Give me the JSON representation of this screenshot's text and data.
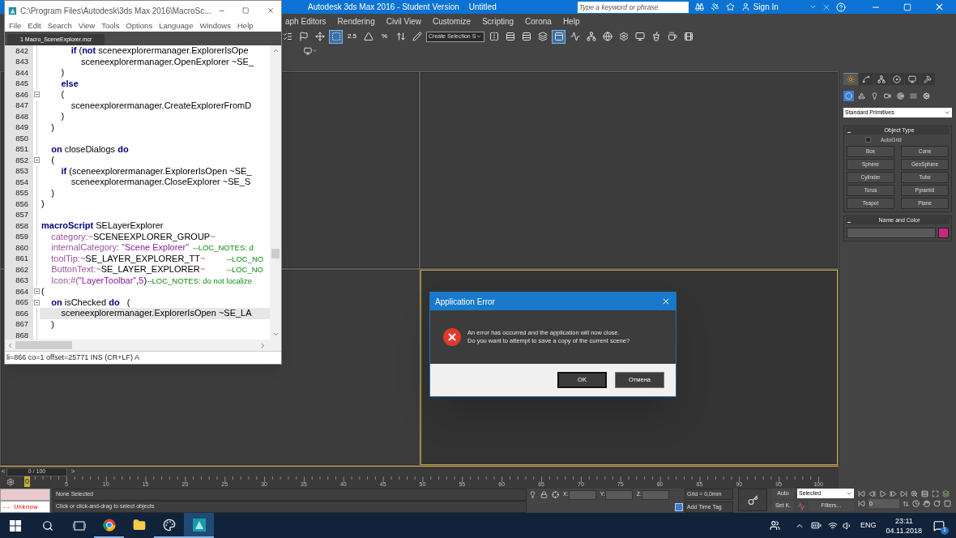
{
  "app_window": {
    "title": "Autodesk 3ds Max 2016 - Student Version",
    "document": "Untitled",
    "search": {
      "placeholder": "Type a keyword or phrase"
    },
    "sign_in": "Sign In"
  },
  "menu": [
    "aph Editors",
    "Rendering",
    "Civil View",
    "Customize",
    "Scripting",
    "Corona",
    "Help"
  ],
  "toolbar": [
    {
      "kind": "icon",
      "selected": false
    },
    {
      "kind": "icon",
      "selected": false
    },
    {
      "kind": "icon",
      "selected": false
    },
    {
      "kind": "icon",
      "selected": true
    },
    {
      "kind": "text",
      "label": "2.5",
      "selected": false
    },
    {
      "kind": "icon",
      "selected": false
    },
    {
      "kind": "text",
      "label": "%",
      "selected": false
    },
    {
      "kind": "icon",
      "selected": false
    },
    {
      "kind": "icon",
      "selected": false
    },
    {
      "kind": "dropdown",
      "label": "Create Selection S",
      "selected": false
    },
    {
      "kind": "icon",
      "selected": false
    },
    {
      "kind": "icon",
      "selected": false
    },
    {
      "kind": "icon",
      "selected": false
    },
    {
      "kind": "icon",
      "selected": false
    },
    {
      "kind": "icon",
      "selected": true
    },
    {
      "kind": "icon",
      "selected": false
    },
    {
      "kind": "icon",
      "selected": false
    },
    {
      "kind": "icon",
      "selected": false
    },
    {
      "kind": "icon",
      "selected": false
    },
    {
      "kind": "icon",
      "selected": false
    },
    {
      "kind": "icon",
      "selected": false
    },
    {
      "kind": "icon",
      "selected": false
    },
    {
      "kind": "icon",
      "selected": false
    }
  ],
  "viewports": [
    {
      "active": false
    },
    {
      "active": false
    },
    {
      "active": false
    },
    {
      "active": true
    }
  ],
  "command_panel": {
    "tabs": [
      {
        "selected": true
      },
      {
        "selected": false
      },
      {
        "selected": false
      },
      {
        "selected": false
      },
      {
        "selected": false
      },
      {
        "selected": false
      }
    ],
    "categories": [
      {
        "selected": true
      },
      {
        "selected": false
      },
      {
        "selected": false
      },
      {
        "selected": false
      },
      {
        "selected": false
      },
      {
        "selected": false
      },
      {
        "selected": false
      }
    ],
    "dropdown": "Standard Primitives",
    "object_type": {
      "title": "Object Type",
      "autogrid": {
        "label": "AutoGrid",
        "checked": false
      },
      "buttons": [
        "Box",
        "Cone",
        "Sphere",
        "GeoSphere",
        "Cylinder",
        "Tube",
        "Torus",
        "Pyramid",
        "Teapot",
        "Plane"
      ]
    },
    "name_and_color": {
      "title": "Name and Color",
      "color": "#c8297f"
    }
  },
  "time_slider": {
    "prev": "<",
    "reading": "0 / 100",
    "next": ">",
    "level": 0
  },
  "ruler": {
    "marker": "0",
    "labels": [
      "5",
      "10",
      "15",
      "20",
      "25",
      "30",
      "35",
      "40",
      "45",
      "50",
      "55",
      "60",
      "65",
      "70",
      "75",
      "80",
      "85",
      "90",
      "95",
      "100"
    ]
  },
  "status": {
    "unknown": "-- Unknow",
    "selection": "None Selected",
    "prompt": "Click or click-and-drag to select objects",
    "coords": [
      "X:",
      "Y:",
      "Z:"
    ],
    "grid": "Grid = 0,0mm",
    "time_tag": "Add Time Tag",
    "auto": "Auto",
    "set_key": "Set K.",
    "key_filter": "Selected",
    "filters": "Filters...",
    "frame": "0"
  },
  "taskbar": {
    "apps": [
      {
        "running": true,
        "selected": false
      },
      {
        "running": false,
        "selected": false
      },
      {
        "running": true,
        "selected": false
      },
      {
        "running": true,
        "selected": true
      }
    ],
    "language": "ENG",
    "time": "23:11",
    "date": "04.11.2018",
    "notifications": "1"
  },
  "editor": {
    "title": "C:\\Program Files\\Autodesk\\3ds Max 2016\\MacroSc...",
    "menu": [
      "File",
      "Edit",
      "Search",
      "View",
      "Tools",
      "Options",
      "Language",
      "Windows",
      "Help"
    ],
    "tabs": [
      {
        "label": "1 Macro_SceneExplorer.mcr",
        "selected": true
      }
    ],
    "lines": [
      {
        "number": "842",
        "fold": false,
        "selected": false,
        "parts": [
          {
            "kind": "keyword",
            "text": "            if"
          },
          {
            "kind": "plain",
            "text": " ("
          },
          {
            "kind": "keyword",
            "text": "not"
          },
          {
            "kind": "plain",
            "text": " sceneexplorermanager.ExplorerIsOpe"
          }
        ]
      },
      {
        "number": "843",
        "fold": false,
        "selected": false,
        "parts": [
          {
            "kind": "plain",
            "text": "                sceneexplorermanager.OpenExplorer ~SE_"
          }
        ]
      },
      {
        "number": "844",
        "fold": false,
        "selected": false,
        "parts": [
          {
            "kind": "plain",
            "text": "        )"
          }
        ]
      },
      {
        "number": "845",
        "fold": false,
        "selected": false,
        "parts": [
          {
            "kind": "keyword",
            "text": "        else"
          }
        ]
      },
      {
        "number": "846",
        "fold": true,
        "selected": false,
        "parts": [
          {
            "kind": "plain",
            "text": "        ("
          }
        ]
      },
      {
        "number": "847",
        "fold": false,
        "selected": false,
        "parts": [
          {
            "kind": "plain",
            "text": "            sceneexplorermanager.CreateExplorerFromD"
          }
        ]
      },
      {
        "number": "848",
        "fold": false,
        "selected": false,
        "parts": [
          {
            "kind": "plain",
            "text": "        )"
          }
        ]
      },
      {
        "number": "849",
        "fold": false,
        "selected": false,
        "parts": [
          {
            "kind": "plain",
            "text": "    )"
          }
        ]
      },
      {
        "number": "850",
        "fold": false,
        "selected": false
      },
      {
        "number": "851",
        "fold": false,
        "selected": false,
        "parts": [
          {
            "kind": "keyword",
            "text": "    on"
          },
          {
            "kind": "plain",
            "text": " closeDialogs "
          },
          {
            "kind": "keyword",
            "text": "do"
          }
        ]
      },
      {
        "number": "852",
        "fold": true,
        "selected": false,
        "parts": [
          {
            "kind": "plain",
            "text": "    ("
          }
        ]
      },
      {
        "number": "853",
        "fold": false,
        "selected": false,
        "parts": [
          {
            "kind": "keyword",
            "text": "        if"
          },
          {
            "kind": "plain",
            "text": " (sceneexplorermanager.ExplorerIsOpen ~SE_"
          }
        ]
      },
      {
        "number": "854",
        "fold": false,
        "selected": false,
        "parts": [
          {
            "kind": "plain",
            "text": "            sceneexplorermanager.CloseExplorer ~SE_S"
          }
        ]
      },
      {
        "number": "855",
        "fold": false,
        "selected": false,
        "parts": [
          {
            "kind": "plain",
            "text": "    )"
          }
        ]
      },
      {
        "number": "856",
        "fold": false,
        "selected": false,
        "parts": [
          {
            "kind": "plain",
            "text": ")"
          }
        ]
      },
      {
        "number": "857",
        "fold": false,
        "selected": false
      },
      {
        "number": "858",
        "fold": false,
        "selected": false,
        "parts": [
          {
            "kind": "keyword",
            "text": "macroScript"
          },
          {
            "kind": "plain",
            "text": " SELayerExplorer"
          }
        ]
      },
      {
        "number": "859",
        "fold": false,
        "selected": false,
        "parts": [
          {
            "kind": "prop",
            "text": "    category:~"
          },
          {
            "kind": "plain",
            "text": "SCENEEXPLORER_GROUP"
          },
          {
            "kind": "prop",
            "text": "~"
          }
        ]
      },
      {
        "number": "860",
        "fold": false,
        "selected": false,
        "parts": [
          {
            "kind": "prop",
            "text": "    internalCategory: "
          },
          {
            "kind": "string",
            "text": "\"Scene Explorer\""
          },
          {
            "kind": "comment",
            "text": "  --LOC_NOTES: d"
          }
        ]
      },
      {
        "number": "861",
        "fold": false,
        "selected": false,
        "parts": [
          {
            "kind": "prop",
            "text": "    toolTip:~"
          },
          {
            "kind": "plain",
            "text": "SE_LAYER_EXPLORER_TT"
          },
          {
            "kind": "prop",
            "text": "~"
          },
          {
            "kind": "comment",
            "text": "          --LOC_NO"
          }
        ]
      },
      {
        "number": "862",
        "fold": false,
        "selected": false,
        "parts": [
          {
            "kind": "prop",
            "text": "    ButtonText:~"
          },
          {
            "kind": "plain",
            "text": "SE_LAYER_EXPLORER"
          },
          {
            "kind": "prop",
            "text": "~"
          },
          {
            "kind": "comment",
            "text": "          --LOC_NO"
          }
        ]
      },
      {
        "number": "863",
        "fold": false,
        "selected": false,
        "parts": [
          {
            "kind": "prop",
            "text": "    Icon:#("
          },
          {
            "kind": "string",
            "text": "\"LayerToolbar\""
          },
          {
            "kind": "plain",
            "text": ","
          },
          {
            "kind": "string",
            "text": "5"
          },
          {
            "kind": "plain",
            "text": ")"
          },
          {
            "kind": "comment",
            "text": "--LOC_NOTES: do not localize"
          }
        ]
      },
      {
        "number": "864",
        "fold": true,
        "selected": false,
        "parts": [
          {
            "kind": "plain",
            "text": "("
          }
        ]
      },
      {
        "number": "865",
        "fold": true,
        "selected": false,
        "parts": [
          {
            "kind": "keyword",
            "text": "    on"
          },
          {
            "kind": "plain",
            "text": " isChecked "
          },
          {
            "kind": "keyword",
            "text": "do"
          },
          {
            "kind": "plain",
            "text": "   ("
          }
        ]
      },
      {
        "number": "866",
        "fold": false,
        "selected": true,
        "parts": [
          {
            "kind": "plain",
            "text": "        sceneexplorermanager.ExplorerIsOpen ~SE_LA"
          }
        ]
      },
      {
        "number": "867",
        "fold": false,
        "selected": false,
        "parts": [
          {
            "kind": "plain",
            "text": "    )"
          }
        ]
      },
      {
        "number": "868",
        "fold": false,
        "selected": false
      }
    ],
    "status": "li=866 co=1 offset=25771 INS (CR+LF) A"
  },
  "dialog": {
    "title": "Application Error",
    "message": [
      "An error has occurred and the application will now close.",
      "Do you want to attempt to save a copy of the current scene?"
    ],
    "buttons": [
      {
        "label": "OK",
        "selected": true
      },
      {
        "label": "Отмена",
        "selected": false
      }
    ]
  }
}
